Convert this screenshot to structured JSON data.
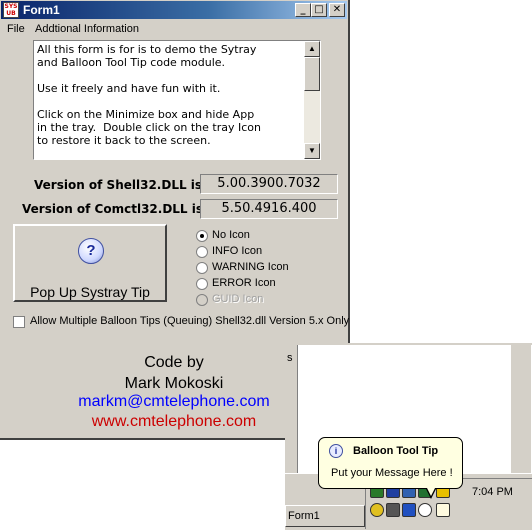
{
  "window": {
    "title": "Form1",
    "app_icon_text": "SYS\nUB",
    "caption_buttons": {
      "minimize": "_",
      "maximize": "□",
      "close": "✕"
    }
  },
  "menu": {
    "items": [
      "File",
      "Addtional Information"
    ]
  },
  "info_text": {
    "paragraphs": [
      "All this form is for is to demo the Sytray\nand Balloon Tool Tip code module.",
      "Use it freely and have fun with it.",
      "Click on the Minimize box and hide App\nin the tray.  Double click on the tray Icon\nto restore it back to the screen."
    ]
  },
  "versions": {
    "shell_label": "Version of Shell32.DLL is",
    "shell_value": "5.00.3900.7032",
    "comctl_label": "Version of Comctl32.DLL is",
    "comctl_value": "5.50.4916.400"
  },
  "popup_button": {
    "icon": "?",
    "label": "Pop Up Systray Tip"
  },
  "icon_options": {
    "selected": "No Icon",
    "items": [
      {
        "label": "No Icon",
        "enabled": true
      },
      {
        "label": "INFO Icon",
        "enabled": true
      },
      {
        "label": "WARNING Icon",
        "enabled": true
      },
      {
        "label": "ERROR Icon",
        "enabled": true
      },
      {
        "label": "GUID Icon",
        "enabled": false
      }
    ]
  },
  "allow_multiple": {
    "checked": false,
    "label": "Allow Multiple Balloon Tips (Queuing) Shell32.dll Version 5.x Only"
  },
  "credits": {
    "line1": "Code by",
    "line2": "Mark Mokoski",
    "email": "markm@cmtelephone.com",
    "website": "www.cmtelephone.com",
    "email_color": "#0000ff",
    "website_color": "#cc0000"
  },
  "background_window": {
    "fragment_text": "s"
  },
  "taskbar": {
    "task_button_label": "Form1",
    "clock": "7:04 PM"
  },
  "balloon": {
    "icon": "i",
    "title": "Balloon Tool Tip",
    "message": "Put your Message Here !"
  },
  "colors": {
    "titlebar_start": "#0a246a",
    "titlebar_end": "#a6caf0",
    "face": "#d4d0c8",
    "balloon_bg": "#ffffe1"
  }
}
